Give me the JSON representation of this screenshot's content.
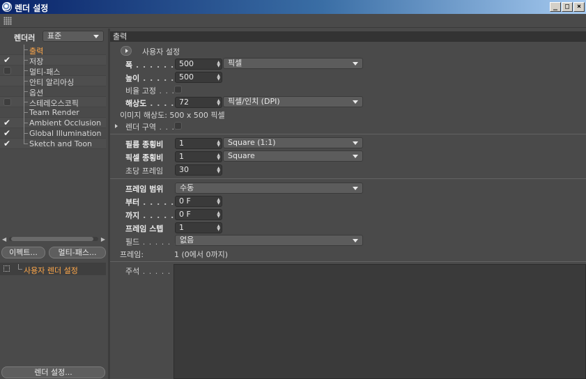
{
  "window": {
    "title": "렌더 설정",
    "controls": {
      "minimize": "_",
      "maximize": "□",
      "close": "×"
    }
  },
  "sidebar": {
    "renderer_label": "렌더러",
    "renderer_value": "표준",
    "items": [
      {
        "label": "출력",
        "checked": null,
        "active": true
      },
      {
        "label": "저장",
        "checked": true,
        "active": false
      },
      {
        "label": "멀티-패스",
        "checked": false,
        "active": false
      },
      {
        "label": "안티 알리아싱",
        "checked": null,
        "active": false
      },
      {
        "label": "옵션",
        "checked": null,
        "active": false
      },
      {
        "label": "스테레오스코픽",
        "checked": false,
        "active": false
      },
      {
        "label": "Team Render",
        "checked": null,
        "active": false
      },
      {
        "label": "Ambient Occlusion",
        "checked": true,
        "active": false
      },
      {
        "label": "Global Illumination",
        "checked": true,
        "active": false
      },
      {
        "label": "Sketch and Toon",
        "checked": true,
        "active": false
      }
    ],
    "effects_button": "이펙트...",
    "multipass_button": "멀티-패스...",
    "custom_setting": "사용자 렌더 설정",
    "render_settings_button": "렌더 설정..."
  },
  "main": {
    "section_title": "출력",
    "preset": "사용자 설정",
    "width_label": "폭",
    "width_value": "500",
    "width_unit": "픽셀",
    "height_label": "높이",
    "height_value": "500",
    "lock_ratio_label": "비율 고정",
    "resolution_label": "해상도",
    "resolution_value": "72",
    "resolution_unit": "픽셀/인치 (DPI)",
    "image_resolution": "이미지 해상도: 500 x 500 픽셀",
    "render_region_label": "렌더 구역",
    "film_aspect_label": "필름 종횡비",
    "film_aspect_value": "1",
    "film_aspect_preset": "Square (1:1)",
    "pixel_aspect_label": "픽셀 종횡비",
    "pixel_aspect_value": "1",
    "pixel_aspect_preset": "Square",
    "fps_label": "초당 프레임",
    "fps_value": "30",
    "frame_range_label": "프레임 범위",
    "frame_range_value": "수동",
    "from_label": "부터",
    "from_value": "0 F",
    "to_label": "까지",
    "to_value": "0 F",
    "frame_step_label": "프레임 스텝",
    "frame_step_value": "1",
    "fields_label": "필드",
    "fields_value": "없음",
    "frames_label": "프레임:",
    "frames_value": "1 (0에서 0까지)",
    "notes_label": "주석"
  }
}
